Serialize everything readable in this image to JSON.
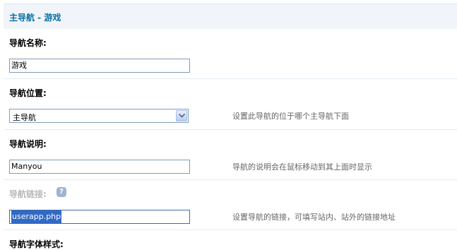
{
  "header": {
    "title": "主导航 - 游戏"
  },
  "fields": {
    "name": {
      "label": "导航名称:",
      "value": "游戏"
    },
    "position": {
      "label": "导航位置:",
      "selected": "主导航",
      "hint": "设置此导航的位于哪个主导航下面"
    },
    "description": {
      "label": "导航说明:",
      "value": "Manyou",
      "hint": "导航的说明会在鼠标移动到其上面时显示"
    },
    "link": {
      "label": "导航链接:",
      "help_glyph": "?",
      "value": "userapp.php",
      "hint": "设置导航的链接，可填写站内、站外的链接地址"
    },
    "font_style": {
      "label": "导航字体样式:"
    }
  }
}
